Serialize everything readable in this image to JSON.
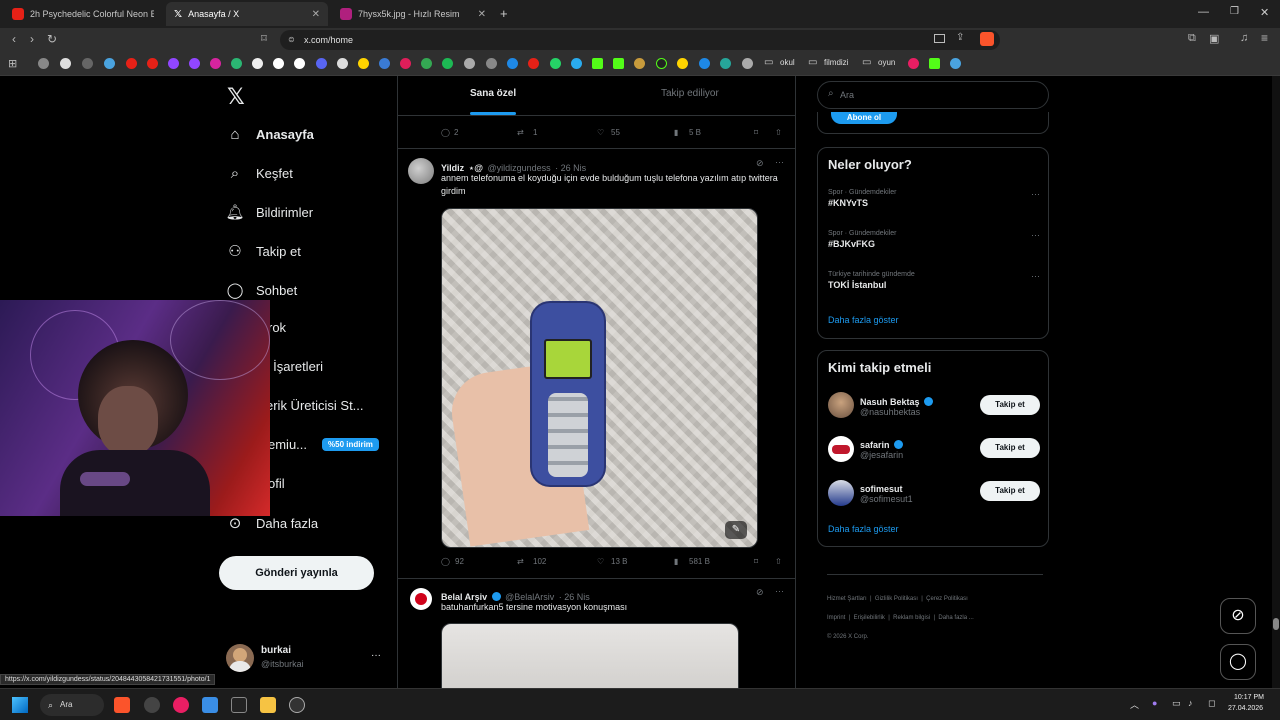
{
  "browser": {
    "tabs": [
      {
        "title": "2h Psychedelic Colorful Neon Backgr",
        "active": false
      },
      {
        "title": "Anasayfa / X",
        "active": true
      },
      {
        "title": "7hysx5k.jpg - Hızlı Resim",
        "active": false
      }
    ],
    "url": "x.com/home",
    "bookmarks": [
      "okul",
      "filmdizi",
      "oyun"
    ]
  },
  "sidebar": {
    "items": [
      {
        "label": "Anasayfa",
        "icon": "home-icon"
      },
      {
        "label": "Keşfet",
        "icon": "search-icon"
      },
      {
        "label": "Bildirimler",
        "icon": "bell-icon"
      },
      {
        "label": "Takip et",
        "icon": "add-user-icon"
      },
      {
        "label": "Sohbet",
        "icon": "chat-icon"
      },
      {
        "label": "rok",
        "icon": "grok-icon"
      },
      {
        "label": "er İşaretleri",
        "icon": "bookmark-icon"
      },
      {
        "label": "erik Üreticisi St...",
        "icon": "studio-icon"
      },
      {
        "label": "emiu...",
        "icon": "premium-icon"
      },
      {
        "label": "ofil",
        "icon": "profile-icon"
      },
      {
        "label": "Daha fazla",
        "icon": "more-icon"
      }
    ],
    "premium_badge": "%50 indirim",
    "post_button": "Gönderi yayınla",
    "account": {
      "name": "burkai",
      "handle": "@itsburkai"
    }
  },
  "feed": {
    "tabs": [
      "Sana özel",
      "Takip ediliyor"
    ],
    "prev_actions": {
      "replies": "2",
      "reposts": "1",
      "likes": "55",
      "views": "5 B"
    },
    "tweets": [
      {
        "name": "Yildiz",
        "handle": "@yildizgundess",
        "date": "· 26 Nis",
        "text": "annem telefonuma el koyduğu için evde bulduğum tuşlu telefona yazılım atıp twittera girdim",
        "actions": {
          "replies": "92",
          "reposts": "102",
          "likes": "13 B",
          "views": "581 B"
        }
      },
      {
        "name": "Belal Arşiv",
        "handle": "@BelalArsiv",
        "date": "· 26 Nis",
        "text": "batuhanfurkan5 tersine motivasyon konuşması"
      }
    ]
  },
  "right": {
    "search_placeholder": "Ara",
    "subscribe_button": "Abone ol",
    "trends_title": "Neler oluyor?",
    "trends": [
      {
        "meta": "Spor · Gündemdekiler",
        "name": "#KNYvTS"
      },
      {
        "meta": "Spor · Gündemdekiler",
        "name": "#BJKvFKG"
      },
      {
        "meta": "Türkiye tarihinde gündemde",
        "name": "TOKİ İstanbul"
      }
    ],
    "trends_more": "Daha fazla göster",
    "follow_title": "Kimi takip etmeli",
    "follow": [
      {
        "name": "Nasuh Bektaş",
        "handle": "@nasuhbektas",
        "button": "Takip et"
      },
      {
        "name": "safarin",
        "handle": "@jesafarin",
        "button": "Takip et"
      },
      {
        "name": "sofimesut",
        "handle": "@sofimesut1",
        "button": "Takip et"
      }
    ],
    "follow_more": "Daha fazla göster",
    "footer": [
      "Hizmet Şartları",
      "Gizlilik Politikası",
      "Çerez Politikası",
      "Imprint",
      "Erişilebilirlik",
      "Reklam bilgisi",
      "Daha fazla ...",
      "© 2026 X Corp."
    ]
  },
  "status_url": "https://x.com/yildizgundess/status/2048443058421731551/photo/1",
  "taskbar": {
    "search": "Ara",
    "time": "10:17 PM",
    "date": "27.04.2026"
  }
}
